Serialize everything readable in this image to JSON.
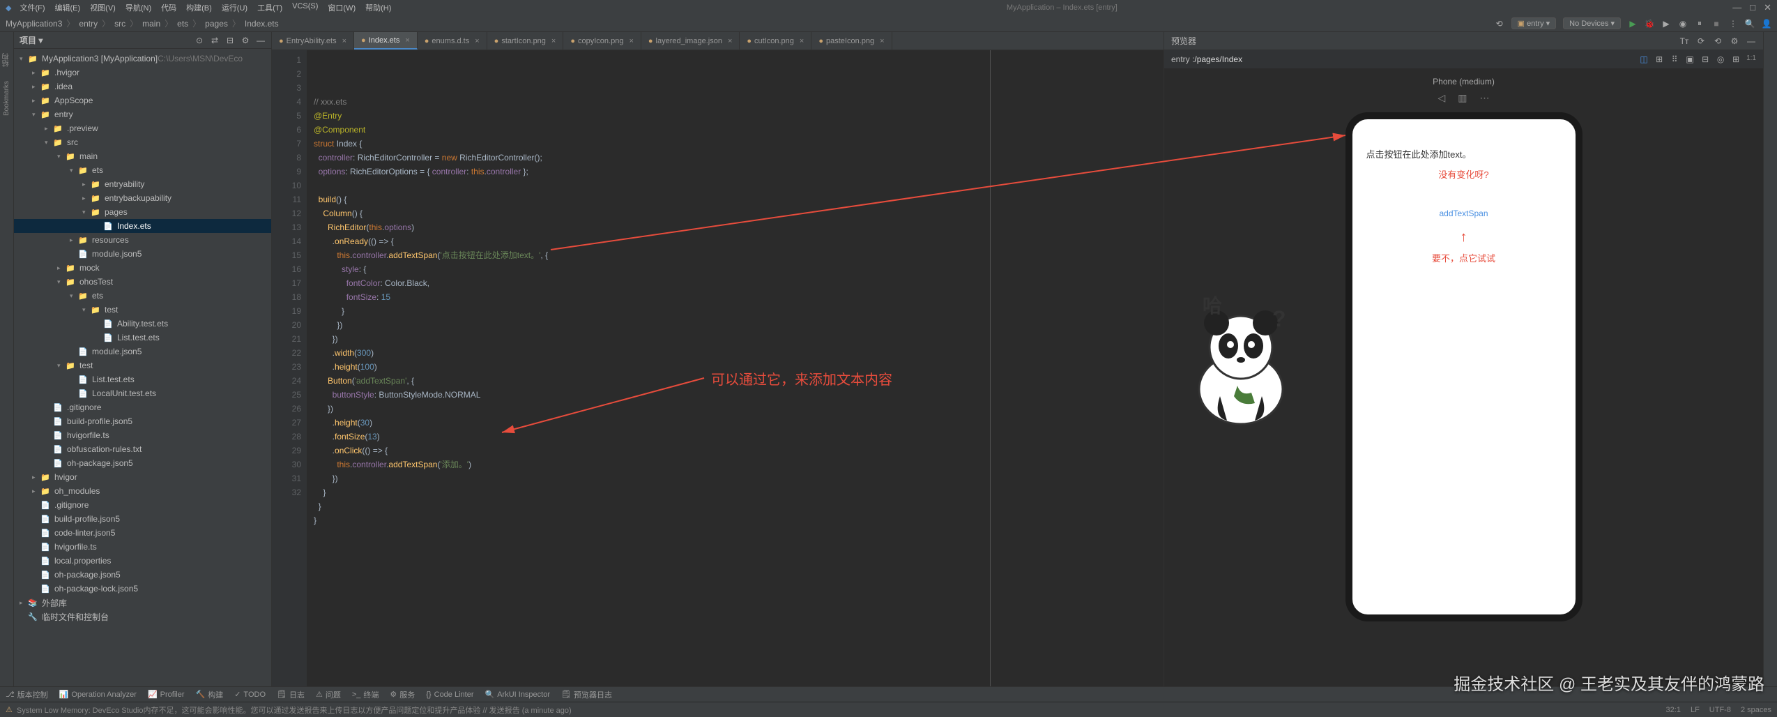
{
  "menu": [
    "文件(F)",
    "编辑(E)",
    "视图(V)",
    "导航(N)",
    "代码",
    "构建(B)",
    "运行(U)",
    "工具(T)",
    "VCS(S)",
    "窗口(W)",
    "帮助(H)"
  ],
  "title_center": "MyApplication – Index.ets [entry]",
  "breadcrumb": [
    "MyApplication3",
    "entry",
    "src",
    "main",
    "ets",
    "pages",
    "Index.ets"
  ],
  "run_config": "entry",
  "device_selector": "No Devices ▾",
  "project_panel_title": "项目 ▾",
  "tree": [
    {
      "d": 0,
      "chev": "▾",
      "icon": "📁",
      "cls": "folder-blue",
      "label": "MyApplication3 [MyApplication]",
      "suffix": "  C:\\Users\\MSN\\DevEco",
      "dim": true
    },
    {
      "d": 1,
      "chev": "▸",
      "icon": "📁",
      "cls": "folder",
      "label": ".hvigor"
    },
    {
      "d": 1,
      "chev": "▸",
      "icon": "📁",
      "cls": "folder",
      "label": ".idea"
    },
    {
      "d": 1,
      "chev": "▸",
      "icon": "📁",
      "cls": "folder-blue",
      "label": "AppScope"
    },
    {
      "d": 1,
      "chev": "▾",
      "icon": "📁",
      "cls": "folder-blue",
      "label": "entry"
    },
    {
      "d": 2,
      "chev": "▸",
      "icon": "📁",
      "cls": "orange",
      "label": ".preview"
    },
    {
      "d": 2,
      "chev": "▾",
      "icon": "📁",
      "cls": "folder-blue",
      "label": "src"
    },
    {
      "d": 3,
      "chev": "▾",
      "icon": "📁",
      "cls": "folder-blue",
      "label": "main"
    },
    {
      "d": 4,
      "chev": "▾",
      "icon": "📁",
      "cls": "folder-blue",
      "label": "ets"
    },
    {
      "d": 5,
      "chev": "▸",
      "icon": "📁",
      "cls": "folder-blue",
      "label": "entryability"
    },
    {
      "d": 5,
      "chev": "▸",
      "icon": "📁",
      "cls": "folder-blue",
      "label": "entrybackupability"
    },
    {
      "d": 5,
      "chev": "▾",
      "icon": "📁",
      "cls": "folder-blue",
      "label": "pages"
    },
    {
      "d": 6,
      "chev": "",
      "icon": "📄",
      "cls": "file-y",
      "label": "Index.ets",
      "selected": true
    },
    {
      "d": 4,
      "chev": "▸",
      "icon": "📁",
      "cls": "folder-blue",
      "label": "resources"
    },
    {
      "d": 4,
      "chev": "",
      "icon": "📄",
      "cls": "file-g",
      "label": "module.json5"
    },
    {
      "d": 3,
      "chev": "▸",
      "icon": "📁",
      "cls": "folder-blue",
      "label": "mock"
    },
    {
      "d": 3,
      "chev": "▾",
      "icon": "📁",
      "cls": "folder-blue",
      "label": "ohosTest"
    },
    {
      "d": 4,
      "chev": "▾",
      "icon": "📁",
      "cls": "folder-blue",
      "label": "ets"
    },
    {
      "d": 5,
      "chev": "▾",
      "icon": "📁",
      "cls": "folder-blue",
      "label": "test"
    },
    {
      "d": 6,
      "chev": "",
      "icon": "📄",
      "cls": "file-y",
      "label": "Ability.test.ets"
    },
    {
      "d": 6,
      "chev": "",
      "icon": "📄",
      "cls": "file-y",
      "label": "List.test.ets"
    },
    {
      "d": 4,
      "chev": "",
      "icon": "📄",
      "cls": "file-g",
      "label": "module.json5"
    },
    {
      "d": 3,
      "chev": "▾",
      "icon": "📁",
      "cls": "folder-blue",
      "label": "test"
    },
    {
      "d": 4,
      "chev": "",
      "icon": "📄",
      "cls": "file-y",
      "label": "List.test.ets"
    },
    {
      "d": 4,
      "chev": "",
      "icon": "📄",
      "cls": "file-y",
      "label": "LocalUnit.test.ets"
    },
    {
      "d": 2,
      "chev": "",
      "icon": "📄",
      "cls": "",
      "label": ".gitignore"
    },
    {
      "d": 2,
      "chev": "",
      "icon": "📄",
      "cls": "file-g",
      "label": "build-profile.json5"
    },
    {
      "d": 2,
      "chev": "",
      "icon": "📄",
      "cls": "",
      "label": "hvigorfile.ts"
    },
    {
      "d": 2,
      "chev": "",
      "icon": "📄",
      "cls": "",
      "label": "obfuscation-rules.txt"
    },
    {
      "d": 2,
      "chev": "",
      "icon": "📄",
      "cls": "file-g",
      "label": "oh-package.json5"
    },
    {
      "d": 1,
      "chev": "▸",
      "icon": "📁",
      "cls": "folder",
      "label": "hvigor"
    },
    {
      "d": 1,
      "chev": "▸",
      "icon": "📁",
      "cls": "orange",
      "label": "oh_modules"
    },
    {
      "d": 1,
      "chev": "",
      "icon": "📄",
      "cls": "",
      "label": ".gitignore"
    },
    {
      "d": 1,
      "chev": "",
      "icon": "📄",
      "cls": "file-g",
      "label": "build-profile.json5"
    },
    {
      "d": 1,
      "chev": "",
      "icon": "📄",
      "cls": "file-g",
      "label": "code-linter.json5"
    },
    {
      "d": 1,
      "chev": "",
      "icon": "📄",
      "cls": "",
      "label": "hvigorfile.ts"
    },
    {
      "d": 1,
      "chev": "",
      "icon": "📄",
      "cls": "",
      "label": "local.properties"
    },
    {
      "d": 1,
      "chev": "",
      "icon": "📄",
      "cls": "file-g",
      "label": "oh-package.json5"
    },
    {
      "d": 1,
      "chev": "",
      "icon": "📄",
      "cls": "file-g",
      "label": "oh-package-lock.json5"
    },
    {
      "d": 0,
      "chev": "▸",
      "icon": "📚",
      "cls": "",
      "label": "外部库"
    },
    {
      "d": 0,
      "chev": "",
      "icon": "🔧",
      "cls": "",
      "label": "临时文件和控制台"
    }
  ],
  "tabs": [
    {
      "label": "EntryAbility.ets",
      "active": false
    },
    {
      "label": "Index.ets",
      "active": true
    },
    {
      "label": "enums.d.ts",
      "active": false
    },
    {
      "label": "startIcon.png",
      "active": false
    },
    {
      "label": "copyIcon.png",
      "active": false
    },
    {
      "label": "layered_image.json",
      "active": false
    },
    {
      "label": "cutIcon.png",
      "active": false
    },
    {
      "label": "pasteIcon.png",
      "active": false
    }
  ],
  "code_lines": [
    "<span class='comm'>// xxx.ets</span>",
    "<span class='ann'>@Entry</span>",
    "<span class='ann'>@Component</span>",
    "<span class='kw'>struct</span> <span class='cls'>Index</span> {",
    "  <span class='prop'>controller</span>: <span class='type'>RichEditorController</span> = <span class='kw'>new</span> <span class='type'>RichEditorController</span>();",
    "  <span class='prop'>options</span>: <span class='type'>RichEditorOptions</span> = { <span class='prop'>controller</span>: <span class='kw'>this</span>.<span class='prop'>controller</span> };",
    "",
    "  <span class='fn'>build</span>() {",
    "    <span class='call'>Column</span>() {",
    "      <span class='call'>RichEditor</span>(<span class='kw'>this</span>.<span class='prop'>options</span>)",
    "        .<span class='call'>onReady</span>(() => {",
    "          <span class='kw'>this</span>.<span class='prop'>controller</span>.<span class='call'>addTextSpan</span>(<span class='str'>'点击按钮在此处添加text。'</span>, {",
    "            <span class='prop'>style</span>: {",
    "              <span class='prop'>fontColor</span>: Color.Black,",
    "              <span class='prop'>fontSize</span>: <span class='num'>15</span>",
    "            }",
    "          })",
    "        })",
    "        .<span class='call'>width</span>(<span class='num'>300</span>)",
    "        .<span class='call'>height</span>(<span class='num'>100</span>)",
    "      <span class='call'>Button</span>(<span class='str'>'addTextSpan'</span>, {",
    "        <span class='prop'>buttonStyle</span>: ButtonStyleMode.NORMAL",
    "      })",
    "        .<span class='call'>height</span>(<span class='num'>30</span>)",
    "        .<span class='call'>fontSize</span>(<span class='num'>13</span>)",
    "        .<span class='call'>onClick</span>(() => {",
    "          <span class='kw'>this</span>.<span class='prop'>controller</span>.<span class='call'>addTextSpan</span>(<span class='str'>'添加。'</span>)",
    "        })",
    "    }",
    "  }",
    "}",
    ""
  ],
  "annotation_editor": "可以通过它，来添加文本内容",
  "preview_title": "预览器",
  "preview_path_prefix": "entry : ",
  "preview_path": "/pages/Index",
  "device_label": "Phone (medium)",
  "phone": {
    "line1": "点击按钮在此处添加text。",
    "line2": "没有变化呀?",
    "button": "addTextSpan",
    "line3": "要不，点它试试"
  },
  "bottom_tools": [
    "版本控制",
    "Operation Analyzer",
    "Profiler",
    "构建",
    "TODO",
    "日志",
    "问题",
    "终端",
    "服务",
    "Code Linter",
    "ArkUI Inspector",
    "预览器日志"
  ],
  "status_msg": "System Low Memory: DevEco Studio内存不足，这可能会影响性能。您可以通过发送报告来上传日志以方便产品问题定位和提升产品体验 // 发送报告 (a minute ago)",
  "status_right": [
    "32:1",
    "LF",
    "UTF-8",
    "2 spaces"
  ],
  "watermark": "掘金技术社区 @ 王老实及其友伴的鸿蒙路"
}
